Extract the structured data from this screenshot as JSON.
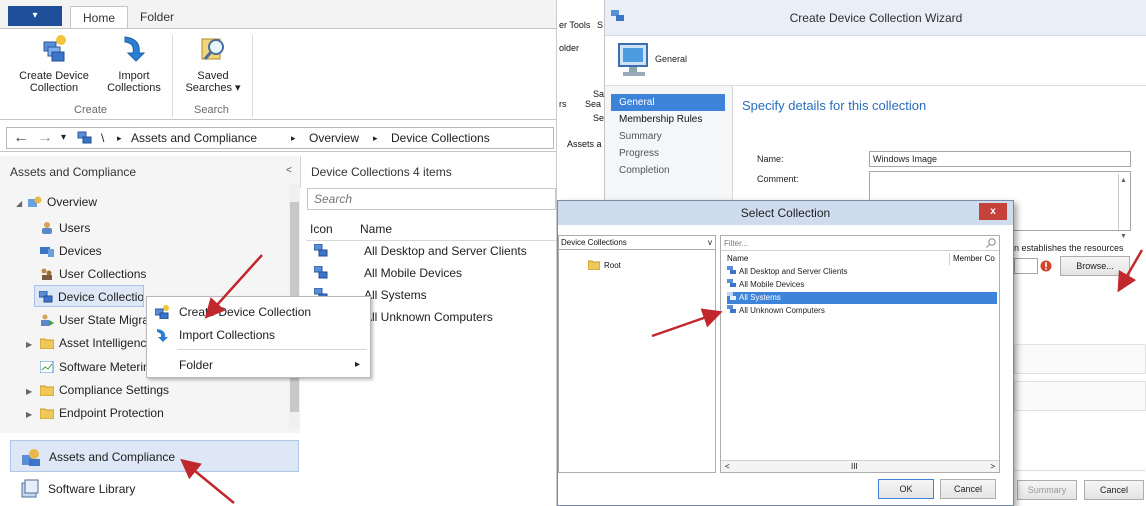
{
  "console": {
    "ribbon": {
      "file_tab": "▾",
      "tabs": [
        "Home",
        "Folder"
      ],
      "buttons": [
        {
          "label": "Create Device Collection",
          "line1": "Create Device",
          "line2": "Collection"
        },
        {
          "label": "Import Collections",
          "line1": "Import",
          "line2": "Collections"
        },
        {
          "label": "Saved Searches",
          "line1": "Saved",
          "line2": "Searches ▾"
        }
      ],
      "groups": [
        "Create",
        "Search"
      ]
    },
    "address_bar": {
      "back": "←",
      "forward": "→",
      "dropdown": "▾",
      "crumbs": [
        "\\",
        "Assets and Compliance",
        "Overview",
        "Device Collections"
      ],
      "separator": "▸"
    },
    "nav": {
      "header": "Assets and Compliance",
      "collapse": "<",
      "tree": [
        {
          "label": "Overview"
        },
        {
          "label": "Users"
        },
        {
          "label": "Devices"
        },
        {
          "label": "User Collections"
        },
        {
          "label": "Device Collections"
        },
        {
          "label": "User State Migration"
        },
        {
          "label": "Asset Intelligence"
        },
        {
          "label": "Software Metering"
        },
        {
          "label": "Compliance Settings"
        },
        {
          "label": "Endpoint Protection"
        }
      ],
      "workspaces": [
        "Assets and Compliance",
        "Software Library"
      ]
    },
    "content": {
      "header": "Device Collections 4 items",
      "search_placeholder": "Search",
      "columns": [
        "Icon",
        "Name"
      ],
      "rows": [
        "All Desktop and Server Clients",
        "All Mobile Devices",
        "All Systems",
        "All Unknown Computers"
      ]
    },
    "context_menu": {
      "items": [
        "Create Device Collection",
        "Import Collections",
        "Folder"
      ],
      "submenu_arrow": "▸"
    }
  },
  "wizard": {
    "behind": {
      "t1": "er Tools",
      "t2": "S",
      "t3": "older",
      "t4": "Sa",
      "t5": "Sea",
      "t6": "rs",
      "t7": "Se",
      "t8": "Assets a"
    },
    "title": "Create Device Collection Wizard",
    "banner": "General",
    "steps": [
      "General",
      "Membership Rules",
      "Summary",
      "Progress",
      "Completion"
    ],
    "heading": "Specify details for this collection",
    "name_label": "Name:",
    "name_value": "Windows Image",
    "comment_label": "Comment:",
    "limiting_text": "n establishes the resources",
    "browse_button": "Browse...",
    "summary_button": "Summary",
    "cancel_button": "Cancel"
  },
  "select_dialog": {
    "title": "Select Collection",
    "close": "x",
    "tree_dropdown": "Device Collections",
    "tree_root": "Root",
    "filter_placeholder": "Filter...",
    "columns": [
      "Name",
      "Member Co"
    ],
    "rows": [
      "All Desktop and Server Clients",
      "All Mobile Devices",
      "All Systems",
      "All Unknown Computers"
    ],
    "selected_index": 2,
    "scroll_mid": "III",
    "ok": "OK",
    "cancel": "Cancel"
  },
  "colors": {
    "accent": "#3d83d9",
    "file_tab": "#1f4e99",
    "arrow": "#c0282d",
    "close": "#c4423a"
  }
}
